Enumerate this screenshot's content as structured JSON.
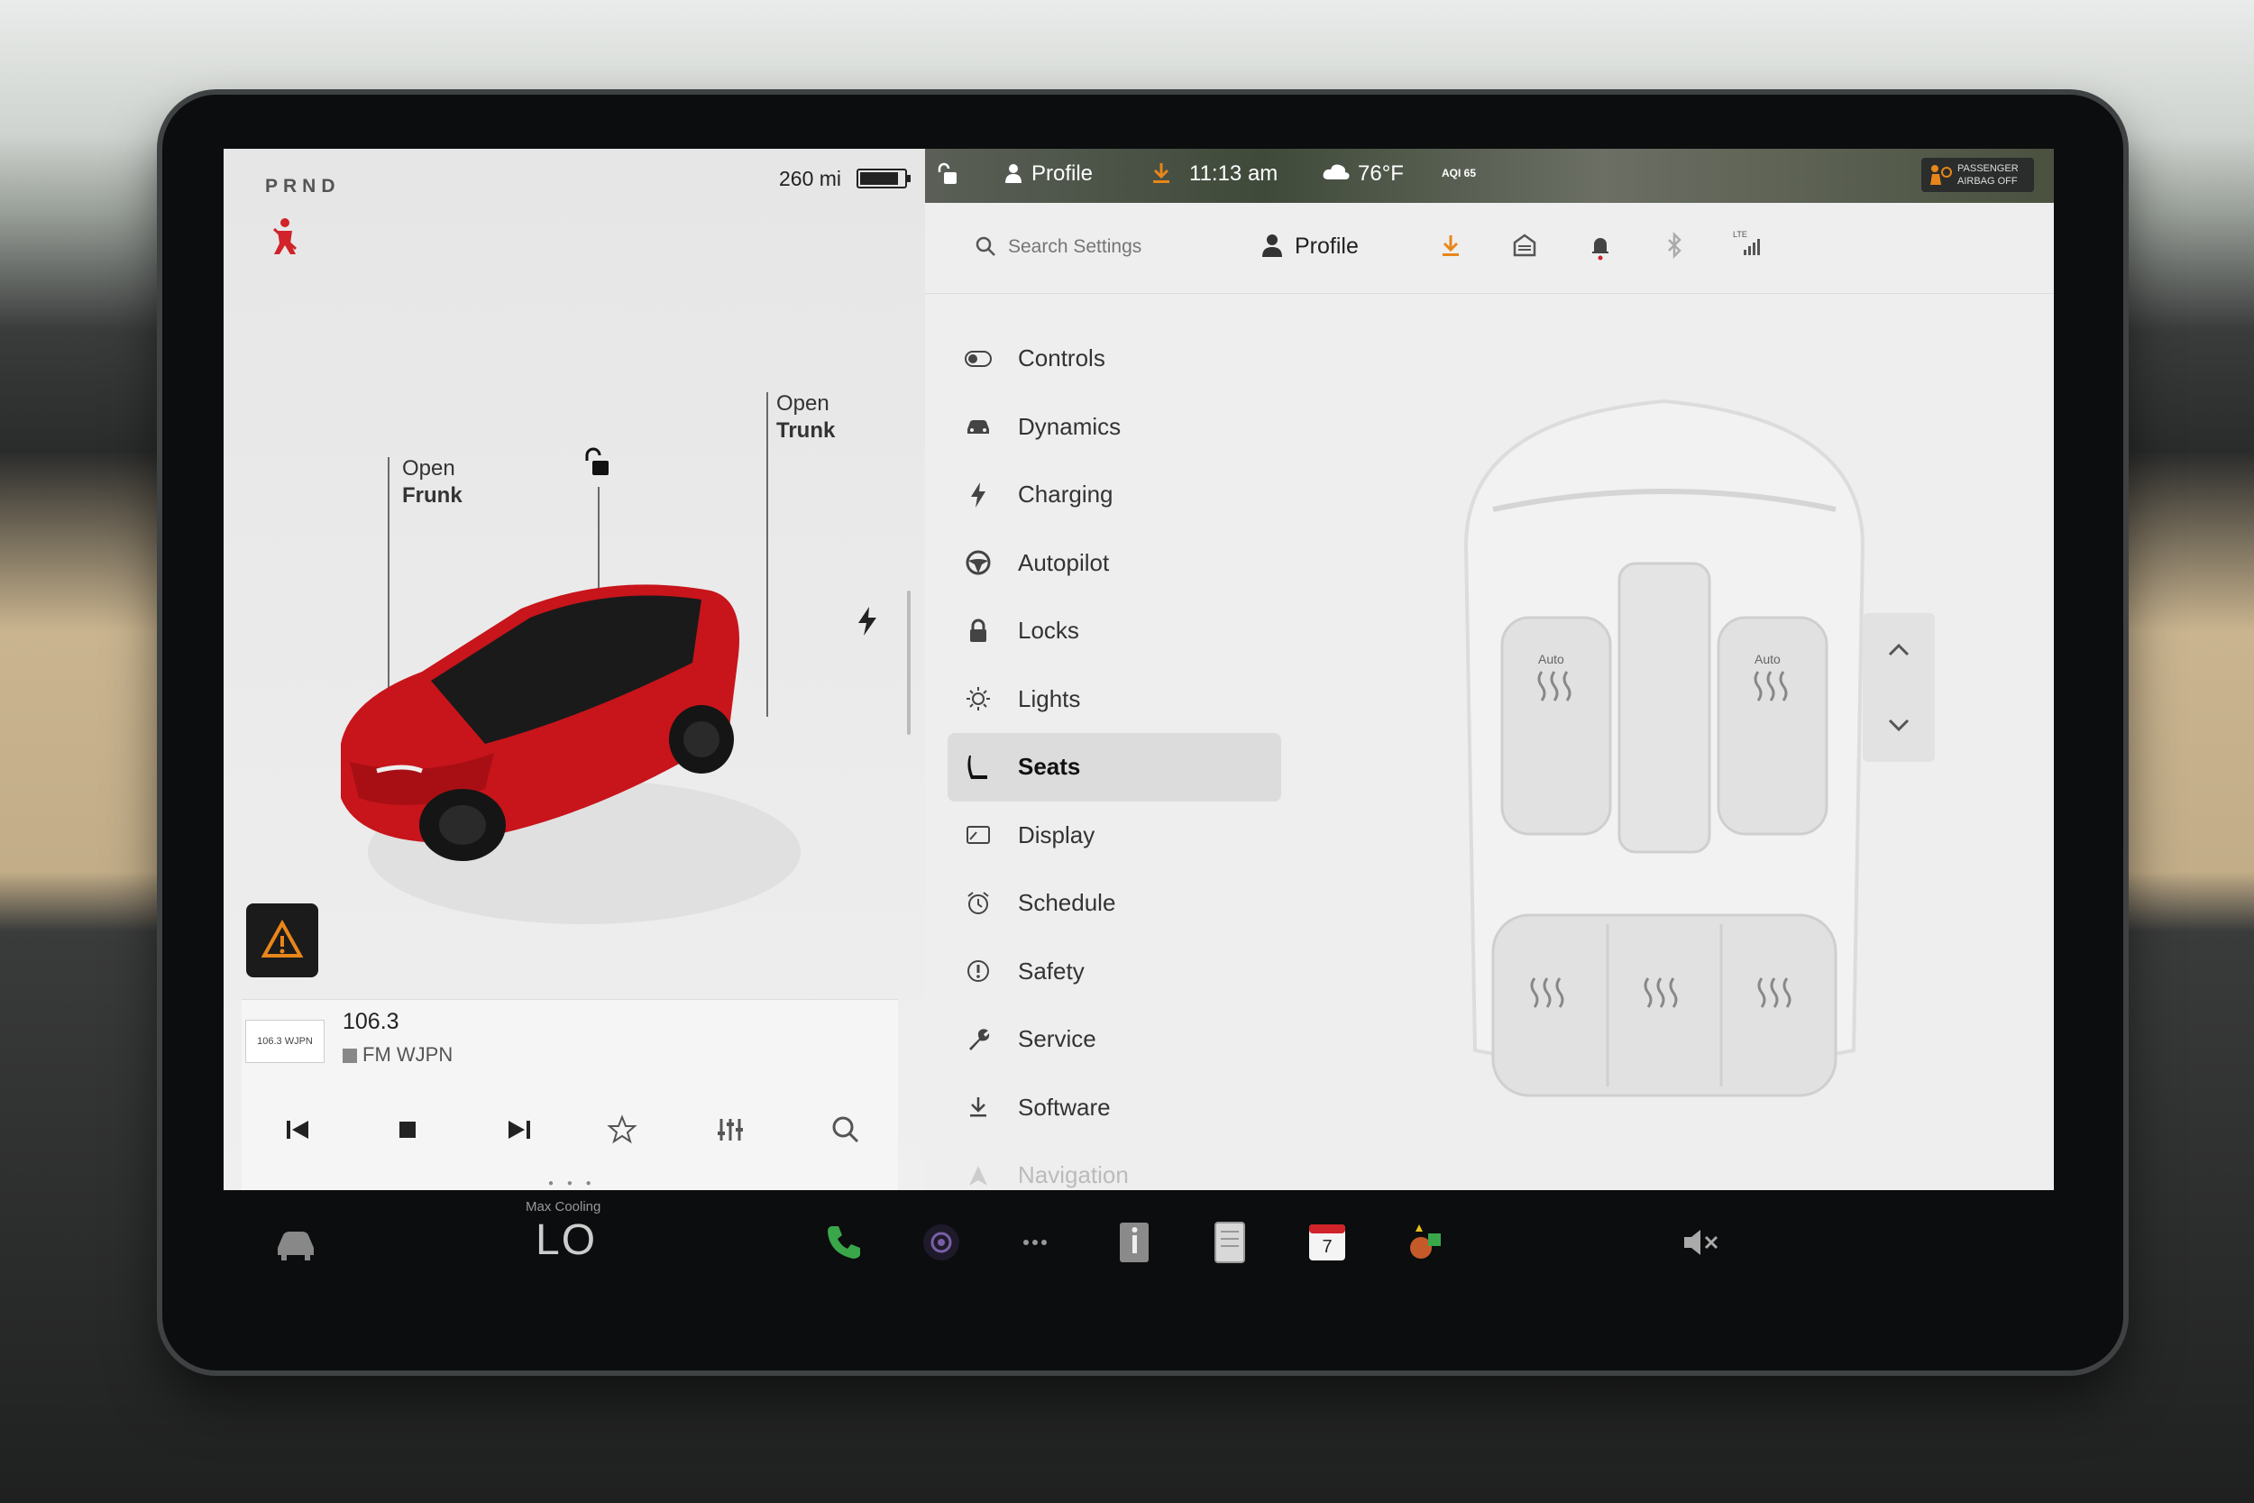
{
  "status": {
    "gear": "PRND",
    "range": "260 mi"
  },
  "car_view": {
    "frunk_label_line1": "Open",
    "frunk_label_line2": "Frunk",
    "trunk_label_line1": "Open",
    "trunk_label_line2": "Trunk"
  },
  "media": {
    "station_logo_text": "106.3 WJPN",
    "frequency": "106.3",
    "station": "FM WJPN"
  },
  "top_bar": {
    "profile": "Profile",
    "time": "11:13 am",
    "temperature": "76°F",
    "aqi": "AQI 65",
    "airbag_line1": "PASSENGER",
    "airbag_line2": "AIRBAG OFF"
  },
  "settings": {
    "search_placeholder": "Search Settings",
    "profile_label": "Profile",
    "lte_label": "LTE",
    "menu": [
      {
        "label": "Controls",
        "icon": "toggle-icon"
      },
      {
        "label": "Dynamics",
        "icon": "car-icon"
      },
      {
        "label": "Charging",
        "icon": "bolt-icon"
      },
      {
        "label": "Autopilot",
        "icon": "steering-wheel-icon"
      },
      {
        "label": "Locks",
        "icon": "lock-icon"
      },
      {
        "label": "Lights",
        "icon": "sun-icon"
      },
      {
        "label": "Seats",
        "icon": "seat-icon",
        "active": true
      },
      {
        "label": "Display",
        "icon": "display-icon"
      },
      {
        "label": "Schedule",
        "icon": "alarm-clock-icon"
      },
      {
        "label": "Safety",
        "icon": "info-circle-icon"
      },
      {
        "label": "Service",
        "icon": "wrench-icon"
      },
      {
        "label": "Software",
        "icon": "download-icon"
      },
      {
        "label": "Navigation",
        "icon": "navigation-arrow-icon"
      }
    ],
    "seat_left_label": "Auto",
    "seat_right_label": "Auto"
  },
  "climate": {
    "max_cooling": "Max Cooling",
    "temperature": "LO"
  },
  "dock": {
    "calendar_day": "7"
  },
  "colors": {
    "accent_orange": "#e8861a",
    "alert_red": "#d0232a",
    "car_red": "#c8141b",
    "phone_green": "#3aa64a"
  }
}
